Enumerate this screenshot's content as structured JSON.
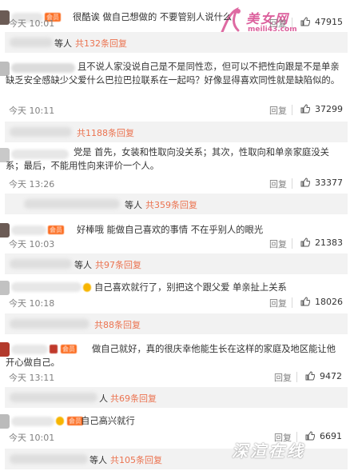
{
  "watermarks": {
    "top_site_name": "美女网",
    "top_site_url": "meili43.com",
    "bottom_brand": "深渲在线"
  },
  "labels": {
    "reply": "回复",
    "thumb_icon": "thumbs-up-icon",
    "vip_badge": "会员"
  },
  "colors": {
    "link_orange": "#eb7350",
    "meta_gray": "#808080",
    "text": "#333333",
    "subreply_bg": "#f2f2f2"
  },
  "comments": [
    {
      "text": "很酷诶 做自己想做的 不要管别人说什么",
      "time": "今天 10:01",
      "likes": "47915",
      "sub": {
        "deng": "等人",
        "more": "共132条回复"
      }
    },
    {
      "text": "且不说人家没说自己是不是同性恋，但可以不把性向跟是不是单亲缺乏安全感缺少父爱什么巴拉巴拉联系在一起吗？好像显得喜欢同性就是缺陷似的。",
      "time": "今天 10:11",
      "likes": "37299",
      "sub": {
        "deng": "",
        "more": "共1188条回复"
      }
    },
    {
      "text": "党是 首先，女装和性取向没关系；其次，性取向和单亲家庭没关系；最后，不能用性向来评价一个人。",
      "time": "今天 13:26",
      "likes": "33377",
      "sub": {
        "deng": "等人",
        "more": "共359条回复"
      }
    },
    {
      "text": "好棒哦 能做自己喜欢的事情 不在乎别人的眼光",
      "time": "今天 10:03",
      "likes": "21383",
      "sub": {
        "deng": "等人",
        "more": "共97条回复"
      }
    },
    {
      "text": "自己喜欢就行了，别把这个跟父爱 单亲扯上关系",
      "time": "今天 10:18",
      "likes": "18026",
      "sub": {
        "deng": "",
        "more": "共88条回复"
      }
    },
    {
      "text": "做自己就好，真的很庆幸他能生长在这样的家庭及地区能让他开心做自己。",
      "time": "今天 13:11",
      "likes": "9472",
      "sub": {
        "deng": "人",
        "more": "共69条回复"
      }
    },
    {
      "text": "自己高兴就行",
      "time": "今天 10:01",
      "likes": "6691",
      "sub": {
        "deng": "等人",
        "more": "共105条回复"
      }
    }
  ]
}
